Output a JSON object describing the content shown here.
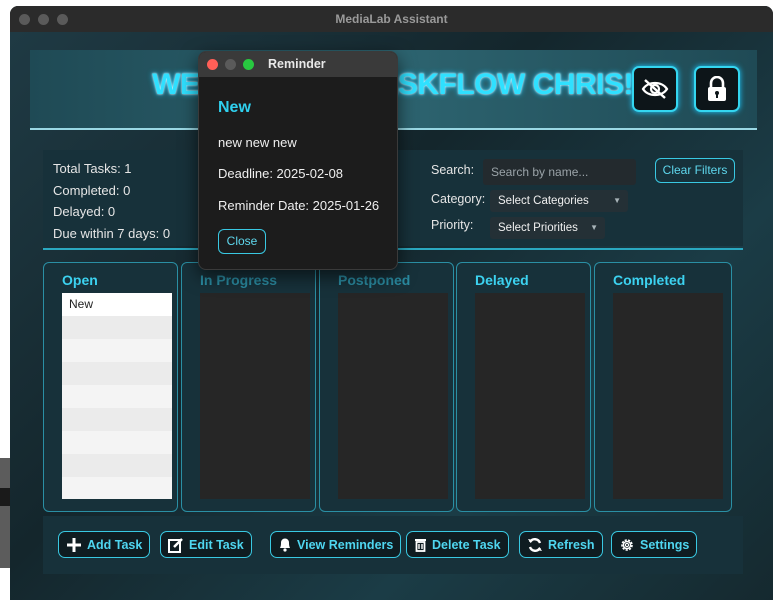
{
  "window": {
    "title": "MediaLab Assistant"
  },
  "header": {
    "welcome_text": "WELCOME TO TASKFLOW CHRIS!",
    "visibility_icon": "eye-slash-icon",
    "lock_icon": "lock-icon"
  },
  "stats": {
    "total": "Total Tasks: 1",
    "completed": "Completed: 0",
    "delayed": "Delayed: 0",
    "due_soon": "Due within 7 days: 0"
  },
  "filters": {
    "search_label": "Search:",
    "search_placeholder": "Search by name...",
    "category_label": "Category:",
    "category_value": "Select Categories",
    "priority_label": "Priority:",
    "priority_value": "Select Priorities",
    "clear_label": "Clear Filters"
  },
  "columns": [
    {
      "title": "Open",
      "tasks": [
        "New"
      ]
    },
    {
      "title": "In Progress",
      "tasks": []
    },
    {
      "title": "Postponed",
      "tasks": []
    },
    {
      "title": "Delayed",
      "tasks": []
    },
    {
      "title": "Completed",
      "tasks": []
    }
  ],
  "footer": {
    "add": "Add Task",
    "edit": "Edit Task",
    "reminders": "View Reminders",
    "delete": "Delete Task",
    "refresh": "Refresh",
    "settings": "Settings"
  },
  "reminder": {
    "window_title": "Reminder",
    "task_name": "New",
    "description": "new new new",
    "deadline": "Deadline: 2025-02-08",
    "reminder_date": "Reminder Date: 2025-01-26",
    "close_label": "Close"
  },
  "colors": {
    "accent": "#2fd0ee",
    "background": "#17313a",
    "close_dot": "#ff5f57",
    "min_dot": "#5a5a5a",
    "max_dot": "#28c840"
  }
}
